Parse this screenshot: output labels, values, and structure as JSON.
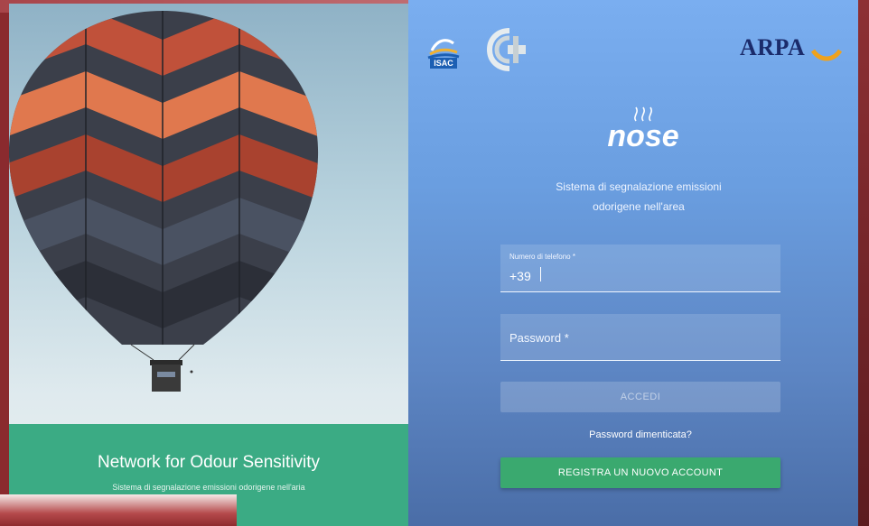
{
  "left_panel": {
    "title": "Network for Odour Sensitivity",
    "subtitle": "Sistema di segnalazione emissioni odorigene nell'aria"
  },
  "header": {
    "isac_label": "ISAC",
    "arpa_label": "ARPA"
  },
  "app": {
    "logo_text": "nose",
    "subtitle_line1": "Sistema di segnalazione emissioni",
    "subtitle_line2": "odorigene nell'area"
  },
  "form": {
    "phone_label": "Numero di telefono *",
    "phone_value": "+39",
    "password_label": "Password *",
    "login_button": "ACCEDI",
    "forgot_link": "Password dimenticata?",
    "register_button": "REGISTRA UN NUOVO ACCOUNT"
  },
  "colors": {
    "accent_green": "#3aa96f",
    "footer_green": "#3bab84",
    "panel_blue": "#6a9ee0"
  }
}
